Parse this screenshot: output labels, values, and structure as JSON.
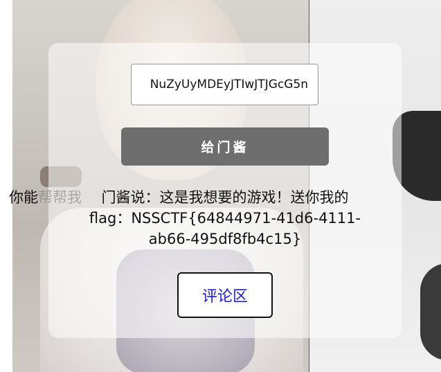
{
  "input": {
    "value": "NuZyUyMDEyJTIwJTJGcG5n"
  },
  "button": {
    "give_label": "给门酱"
  },
  "scroll_text": {
    "lead": "，你能",
    "faded": "帮帮我"
  },
  "result": {
    "line1": "门酱说：这是我想要的游戏！送你我的",
    "line2": "flag：NSSCTF{64844971-41d6-4111-",
    "line3": "ab66-495df8fb4c15}"
  },
  "comment": {
    "label": "评论区",
    "color": "#1a1aee"
  },
  "colors": {
    "button_bg": "#6e6e6e",
    "panel_bg": "rgba(255,255,255,0.55)"
  }
}
